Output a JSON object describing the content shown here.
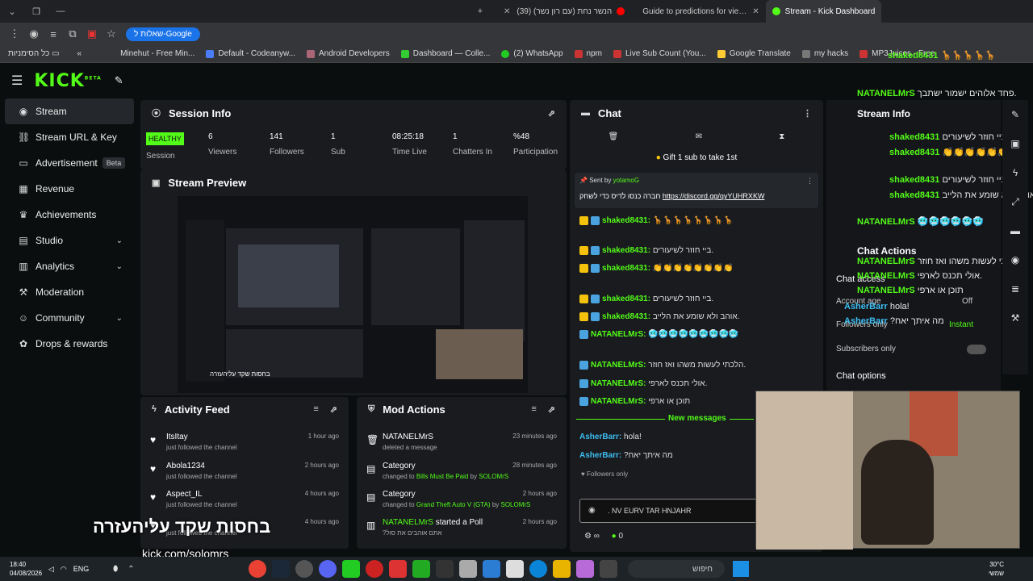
{
  "browser": {
    "tabs": [
      {
        "label": "(39) הנשר נחת (עם רון נשר)"
      },
      {
        "label": "Guide to predictions for viewers"
      },
      {
        "label": "Stream - Kick Dashboard"
      }
    ],
    "search_pill": "שאלות ל-Google",
    "bookmarks": [
      "Minehut - Free Min...",
      "Default - Codeanyw...",
      "Android Developers",
      "Dashboard — Colle...",
      "(2) WhatsApp",
      "npm",
      "Live Sub Count (You...",
      "Google Translate",
      "my hacks",
      "MP3Juices - Free"
    ],
    "all_bookmarks": "כל הסימניות"
  },
  "sidebar": {
    "items": [
      {
        "label": "Stream",
        "icon": "broadcast-icon"
      },
      {
        "label": "Stream URL & Key",
        "icon": "link-icon"
      },
      {
        "label": "Advertisement",
        "icon": "ad-icon",
        "badge": "Beta"
      },
      {
        "label": "Revenue",
        "icon": "revenue-icon"
      },
      {
        "label": "Achievements",
        "icon": "trophy-icon"
      },
      {
        "label": "Studio",
        "icon": "studio-icon"
      },
      {
        "label": "Analytics",
        "icon": "analytics-icon"
      },
      {
        "label": "Moderation",
        "icon": "gavel-icon"
      },
      {
        "label": "Community",
        "icon": "community-icon"
      },
      {
        "label": "Drops & rewards",
        "icon": "gift-icon"
      }
    ]
  },
  "session": {
    "title": "Session Info",
    "health": "HEALTHY",
    "health_label": "Session",
    "stats": [
      {
        "value": "6",
        "label": "Viewers"
      },
      {
        "value": "141",
        "label": "Followers"
      },
      {
        "value": "1",
        "label": "Sub"
      },
      {
        "value": "08:25:18",
        "label": "Time Live"
      },
      {
        "value": "1",
        "label": "Chatters In"
      },
      {
        "value": "%48",
        "label": "Participation"
      }
    ]
  },
  "preview": {
    "title": "Stream Preview"
  },
  "activity": {
    "title": "Activity Feed",
    "items": [
      {
        "name": "ItsItay",
        "desc": "just followed the channel",
        "time": "1 hour ago"
      },
      {
        "name": "Abola1234",
        "desc": "just followed the channel",
        "time": "2 hours ago"
      },
      {
        "name": "Aspect_IL",
        "desc": "just followed the channel",
        "time": "4 hours ago"
      },
      {
        "name": "",
        "desc": "just followed the channel",
        "time": "4 hours ago"
      }
    ]
  },
  "mod": {
    "title": "Mod Actions",
    "items": [
      {
        "name": "NATANELMrS",
        "desc": "deleted a message",
        "time": "23 minutes ago"
      },
      {
        "name": "Category",
        "desc": "changed to",
        "cat": "Bills Must Be Paid",
        "by": "by",
        "user": "SOLOMrS",
        "time": "28 minutes ago"
      },
      {
        "name": "Category",
        "desc": "changed to",
        "cat": "Grand Theft Auto V (GTA)",
        "by": "by",
        "user": "SOLOMrS",
        "time": "2 hours ago"
      },
      {
        "name": "NATANELMrS",
        "action": "started a Poll",
        "desc": "?אתם אוהבים את סול",
        "time": "2 hours ago"
      }
    ]
  },
  "chat": {
    "title": "Chat",
    "gift": "Gift 1 sub to take 1st",
    "pinned": {
      "sent_by": "Sent by",
      "user": "yotamoG",
      "text": "חברה כנסו לדיס כדי לשחק",
      "link": "https://discord.gg/qyYUHRXKW"
    },
    "messages": [
      {
        "user": "shaked8431:",
        "text": "🦒🦒🦒🦒🦒🦒🦒🦒"
      },
      {
        "user": "shaked8431:",
        "text": "ביי חוזר לשיעורים."
      },
      {
        "user": "shaked8431:",
        "text": "👏👏👏👏👏👏👏👏"
      },
      {
        "user": "shaked8431:",
        "text": "ביי חוזר לשיעורים."
      },
      {
        "user": "shaked8431:",
        "text": "אוהב ולא שומע את הלייב."
      },
      {
        "user": "NATANELMrS:",
        "text": "🥶🥶🥶🥶🥶🥶🥶🥶🥶"
      },
      {
        "user": "NATANELMrS:",
        "text": "הלכתי לעשות משהו ואז חוזר."
      },
      {
        "user": "NATANELMrS:",
        "text": "אולי תכנס לארפי."
      },
      {
        "user": "NATANELMrS:",
        "text": "תוכן או ארפי"
      }
    ],
    "new_messages": "New messages",
    "new": [
      {
        "user": "AsherBarr:",
        "text": "hola!"
      },
      {
        "user": "AsherBarr:",
        "text": "?מה איתך יאח"
      }
    ],
    "followers_only": "Followers only",
    "input_value": ". NV EURV TAR HNJAHR",
    "points": "0"
  },
  "overlay": {
    "stream_info": "Stream Info",
    "chat_actions": "Chat Actions",
    "chat_access": "Chat access",
    "account_age": "Account age",
    "account_age_val": "Off",
    "followers": "Followers only",
    "followers_val": "Instant",
    "subscribers": "Subscribers only",
    "chat_options": "Chat options",
    "messages": [
      {
        "user": "shaked8431",
        "text": "🦒🦒🦒🦒🦒"
      },
      {
        "user": "NATANELMrS",
        "text": "פחד אלוהים ישמור ישתבך."
      },
      {
        "user": "shaked8431",
        "text": "ביי חוזר לשיעורים."
      },
      {
        "user": "shaked8431",
        "text": "👏👏👏👏👏👏"
      },
      {
        "user": "shaked8431",
        "text": "ביי חוזר לשיעורים."
      },
      {
        "user": "shaked8431",
        "text": "אוהב ולא שומע את הלייב."
      },
      {
        "user": "NATANELMrS",
        "text": "🥶🥶🥶🥶🥶🥶"
      },
      {
        "user": "NATANELMrS",
        "text": "הלכתי לעשות משהו ואז חוזר."
      },
      {
        "user": "NATANELMrS",
        "text": "אולי תכנס לארפי."
      },
      {
        "user": "NATANELMrS",
        "text": "תוכן או ארפי"
      },
      {
        "user": "AsherBarr",
        "text": "hola!"
      },
      {
        "user": "AsherBarr",
        "text": "?מה איתך יאח"
      }
    ]
  },
  "captions": {
    "hebrew": "בחסות שקד עליהעזרה",
    "url": "kick.com/solomrs"
  },
  "taskbar": {
    "time": "18:40",
    "date": "04/08/2026",
    "lang": "ENG",
    "search": "חיפוש",
    "temp": "30°C",
    "weather": "שמשי"
  },
  "colors": {
    "accent": "#53fc18",
    "panel": "#191b1f",
    "bg": "#0b0e0f"
  }
}
